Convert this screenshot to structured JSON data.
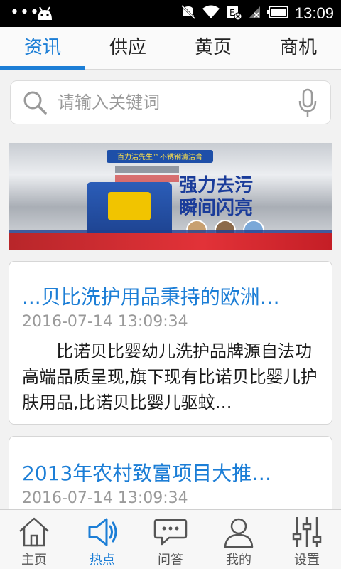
{
  "status_bar": {
    "time": "13:09",
    "icons": [
      "dots-icon",
      "android-icon",
      "mute-icon",
      "wifi-icon",
      "e-signal-icon",
      "no-signal-icon",
      "battery-charging-icon"
    ]
  },
  "tabs": [
    {
      "label": "资讯",
      "active": true
    },
    {
      "label": "供应",
      "active": false
    },
    {
      "label": "黄页",
      "active": false
    },
    {
      "label": "商机",
      "active": false
    }
  ],
  "search": {
    "placeholder": "请输入关键词",
    "value": "",
    "icon": "search-icon",
    "voice_icon": "mic-icon"
  },
  "banner": {
    "tagline": "百力洁先生™不锈钢清洁膏",
    "headline_line1": "强力去污",
    "headline_line2": "瞬间闪亮"
  },
  "articles": [
    {
      "title": "...贝比洗护用品秉持的欧洲…",
      "date": "2016-07-14 13:09:34",
      "summary": "比诺贝比婴幼儿洗护品牌源自法功高端品质呈现,旗下现有比诺贝比婴儿护肤用品,比诺贝比婴儿驱蚊…"
    },
    {
      "title": "2013年农村致富项目大推…",
      "date": "2016-07-14 13:09:34",
      "summary": ""
    }
  ],
  "bottom_nav": [
    {
      "label": "主页",
      "icon": "home-icon",
      "active": false
    },
    {
      "label": "热点",
      "icon": "megaphone-icon",
      "active": true
    },
    {
      "label": "问答",
      "icon": "chat-icon",
      "active": false
    },
    {
      "label": "我的",
      "icon": "user-icon",
      "active": false
    },
    {
      "label": "设置",
      "icon": "sliders-icon",
      "active": false
    }
  ],
  "colors": {
    "accent": "#1c7ed6",
    "status_bar": "#000000",
    "background": "#f2f2f2"
  }
}
